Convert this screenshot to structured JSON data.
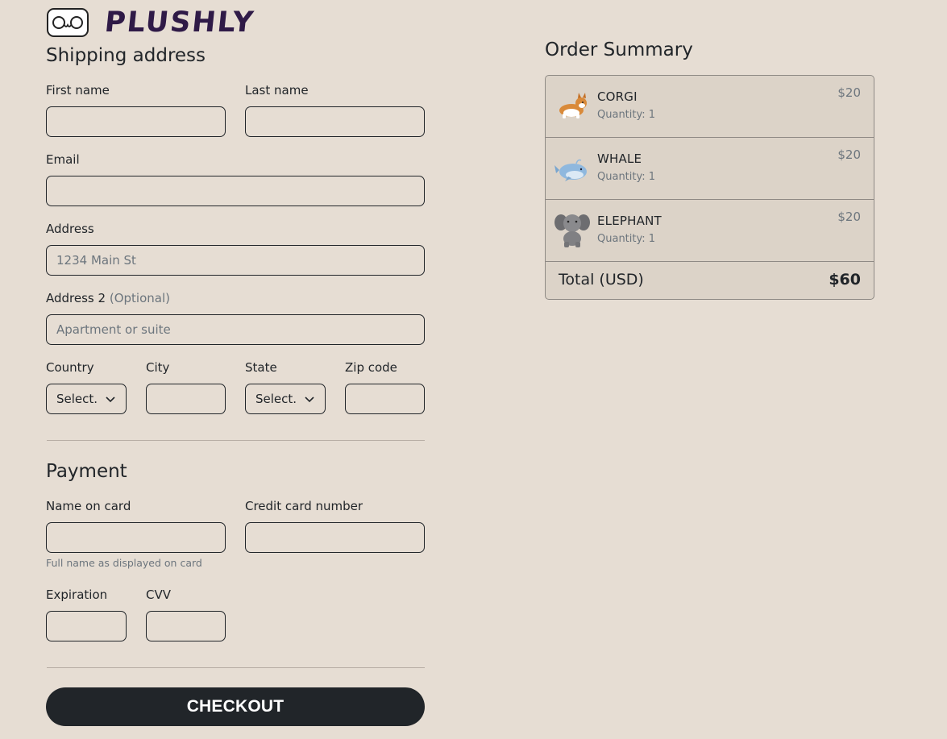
{
  "brand": {
    "name": "PLUSHLY",
    "logo_face": "o ᴗ o"
  },
  "shipping": {
    "title": "Shipping address",
    "first_name_label": "First name",
    "last_name_label": "Last name",
    "email_label": "Email",
    "address_label": "Address",
    "address_placeholder": "1234 Main St",
    "address2_label": "Address 2",
    "address2_optional": "(Optional)",
    "address2_placeholder": "Apartment or suite",
    "country_label": "Country",
    "country_value": "Select.",
    "city_label": "City",
    "state_label": "State",
    "state_value": "Select.",
    "zip_label": "Zip code"
  },
  "payment": {
    "title": "Payment",
    "name_on_card_label": "Name on card",
    "name_on_card_help": "Full name as displayed on card",
    "card_number_label": "Credit card number",
    "expiration_label": "Expiration",
    "cvv_label": "CVV"
  },
  "checkout_label": "CHECKOUT",
  "order_summary": {
    "title": "Order Summary",
    "items": [
      {
        "name": "CORGI",
        "quantity": "Quantity: 1",
        "price": "$20",
        "icon": "corgi-plush"
      },
      {
        "name": "WHALE",
        "quantity": "Quantity: 1",
        "price": "$20",
        "icon": "whale-plush"
      },
      {
        "name": "ELEPHANT",
        "quantity": "Quantity: 1",
        "price": "$20",
        "icon": "elephant-plush"
      }
    ],
    "total_label": "Total (USD)",
    "total_value": "$60"
  },
  "colors": {
    "background": "#e6ddd3",
    "summary_bg": "#dcd3c8",
    "button": "#212529",
    "brand": "#2f1a47"
  }
}
